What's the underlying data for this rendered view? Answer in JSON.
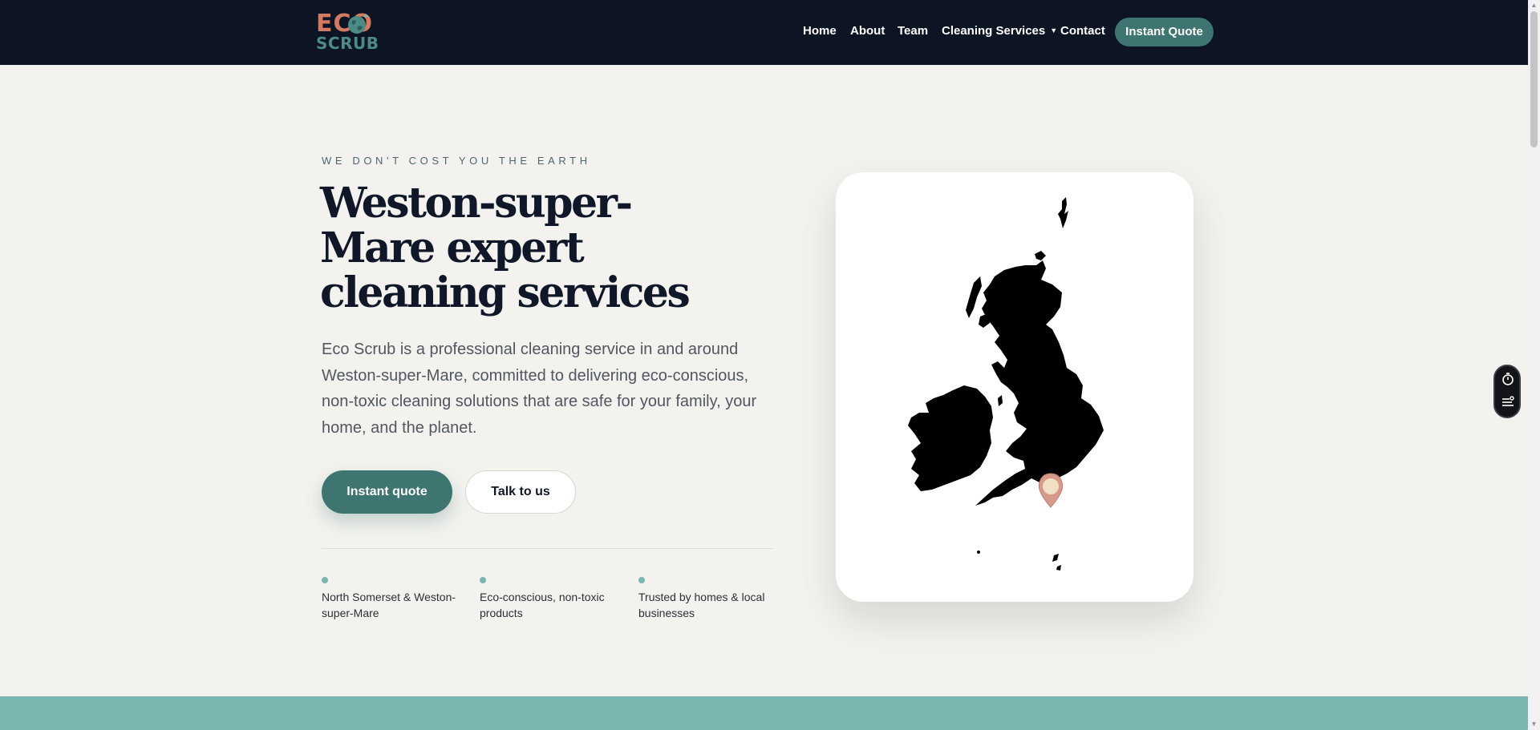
{
  "brand": {
    "logo_line1": "ECO",
    "logo_line2": "SCRUB",
    "colors": {
      "nav_bg": "#0d1424",
      "accent": "#3e7570",
      "logo_orange": "#d27b60",
      "band": "#7ab5af"
    }
  },
  "nav": {
    "items": [
      {
        "label": "Home"
      },
      {
        "label": "About"
      },
      {
        "label": "Team"
      },
      {
        "label": "Cleaning Services"
      },
      {
        "label": "Contact"
      }
    ],
    "quote_button": "Instant Quote"
  },
  "hero": {
    "eyebrow": "WE DON'T COST YOU THE EARTH",
    "title": "Weston-super-Mare expert cleaning services",
    "description": "Eco Scrub is a professional cleaning service in and around Weston-super-Mare, committed to delivering eco-conscious, non-toxic cleaning solutions that are safe for your family, your home, and the planet.",
    "primary_button": "Instant quote",
    "secondary_button": "Talk to us",
    "features": [
      {
        "text": "North Somerset & Weston-super-Mare"
      },
      {
        "text": "Eco-conscious, non-toxic products"
      },
      {
        "text": "Trusted by homes & local businesses"
      }
    ]
  },
  "map": {
    "marker_icon": "location-pin-icon"
  },
  "widget": {
    "icons": [
      "timer-icon",
      "list-settings-icon"
    ]
  }
}
